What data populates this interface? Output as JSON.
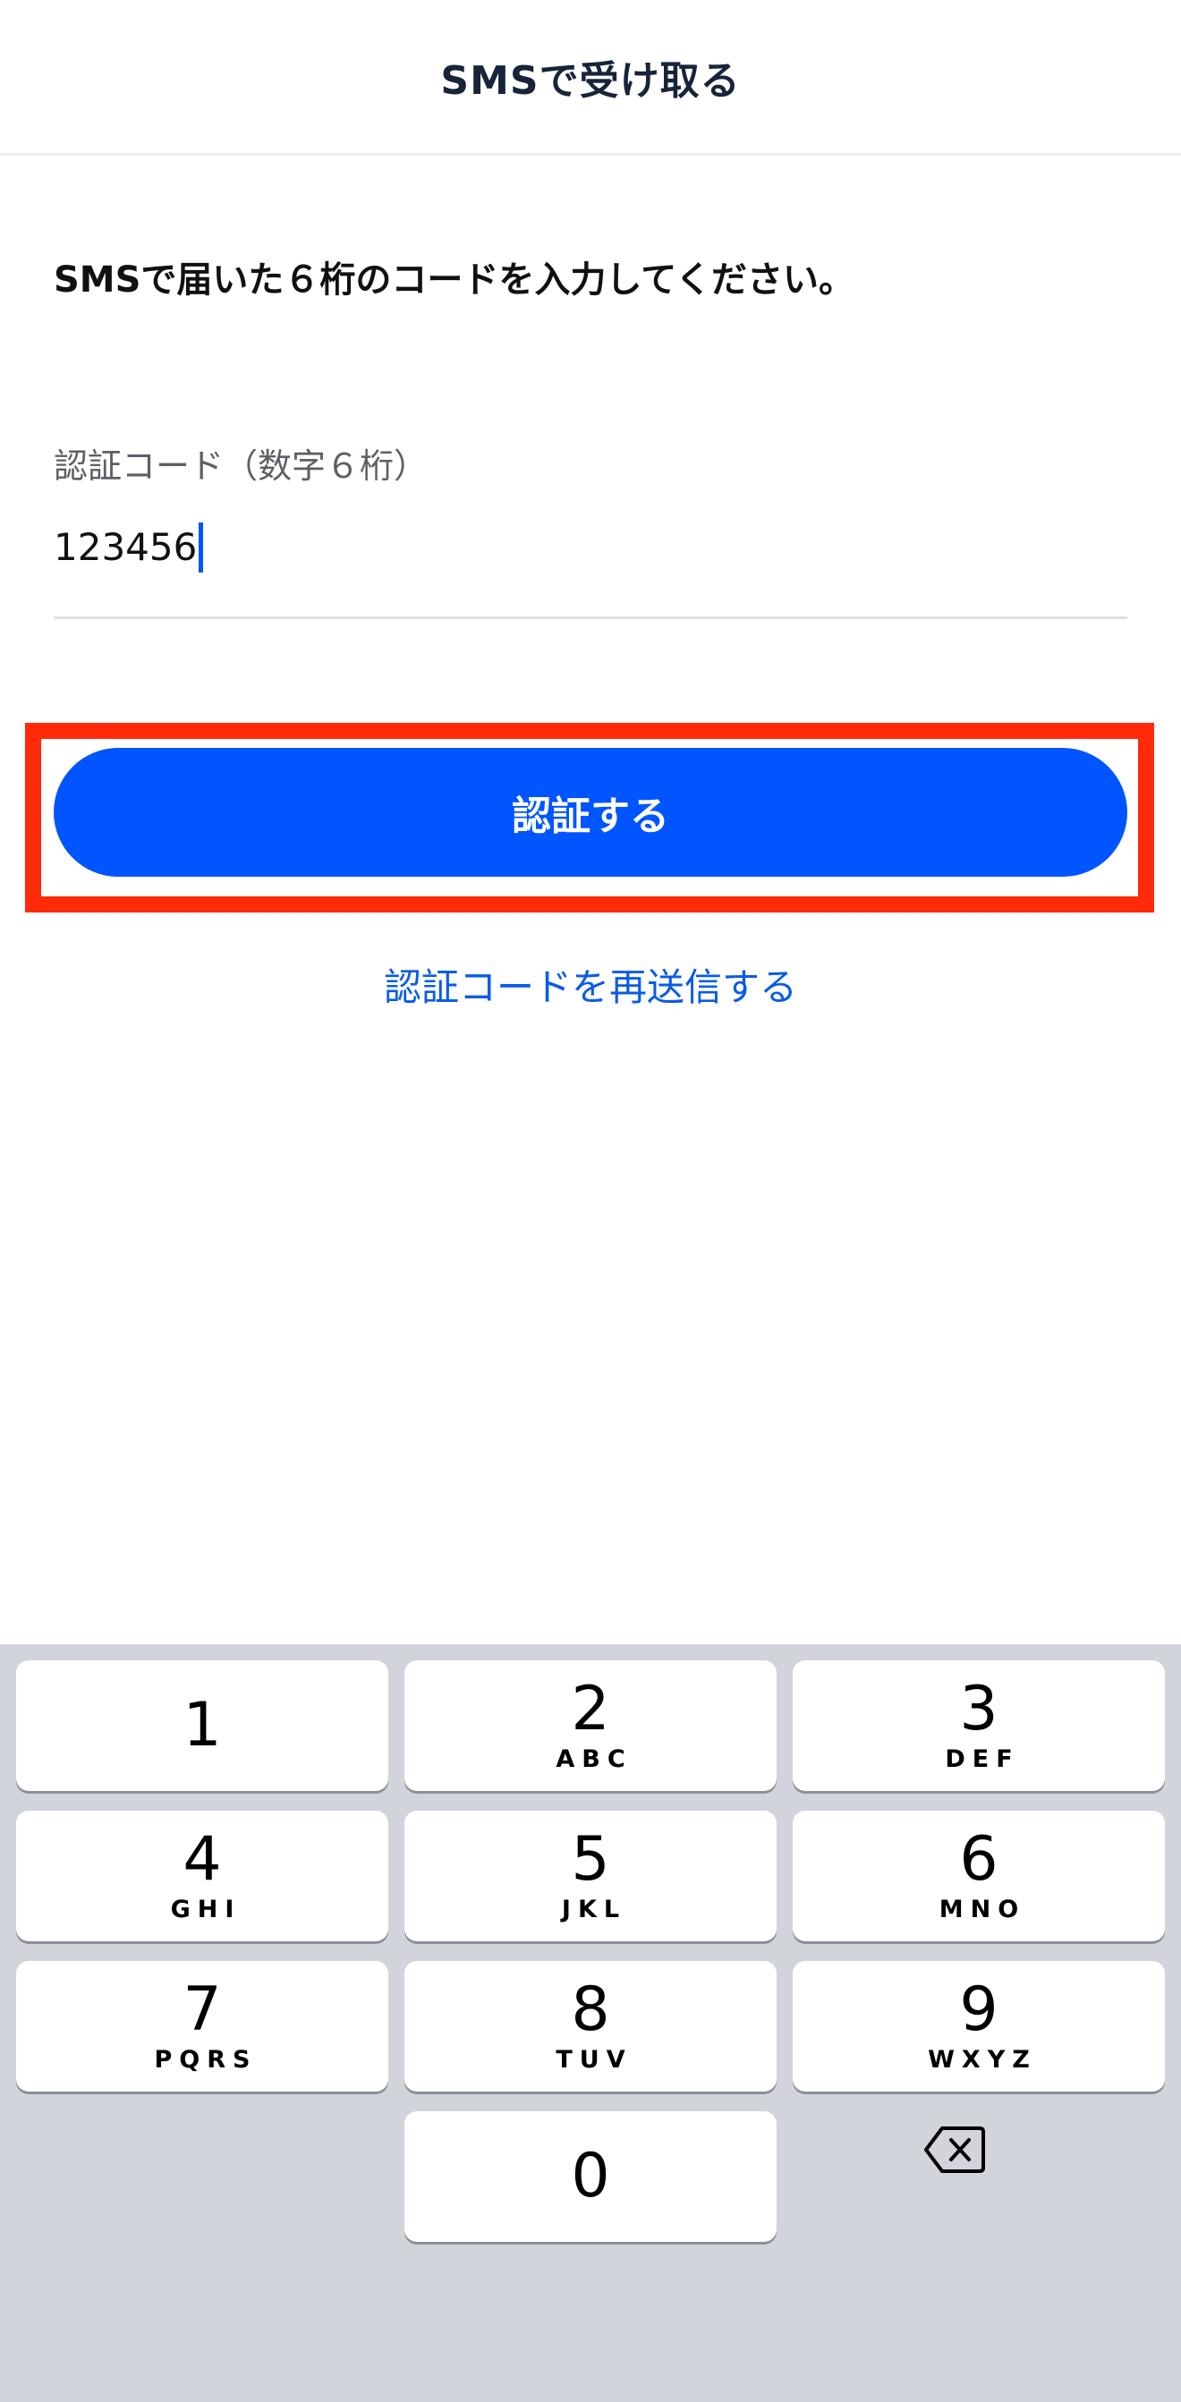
{
  "header": {
    "title": "SMSで受け取る"
  },
  "instruction": "SMSで届いた６桁のコードを入力してください。",
  "field": {
    "label": "認証コード（数字６桁）",
    "value": "123456"
  },
  "verify_button": {
    "label": "認証する"
  },
  "resend_link": {
    "label": "認証コードを再送信する"
  },
  "keypad": {
    "keys": [
      {
        "digit": "1",
        "letters": ""
      },
      {
        "digit": "2",
        "letters": "ABC"
      },
      {
        "digit": "3",
        "letters": "DEF"
      },
      {
        "digit": "4",
        "letters": "GHI"
      },
      {
        "digit": "5",
        "letters": "JKL"
      },
      {
        "digit": "6",
        "letters": "MNO"
      },
      {
        "digit": "7",
        "letters": "PQRS"
      },
      {
        "digit": "8",
        "letters": "TUV"
      },
      {
        "digit": "9",
        "letters": "WXYZ"
      },
      {
        "digit": "0",
        "letters": ""
      }
    ],
    "backspace_icon": "backspace-icon"
  },
  "colors": {
    "primary": "#0055ff",
    "highlight": "#ff2a0a",
    "link": "#0a5ce6",
    "keypad_bg": "#d1d4db"
  }
}
